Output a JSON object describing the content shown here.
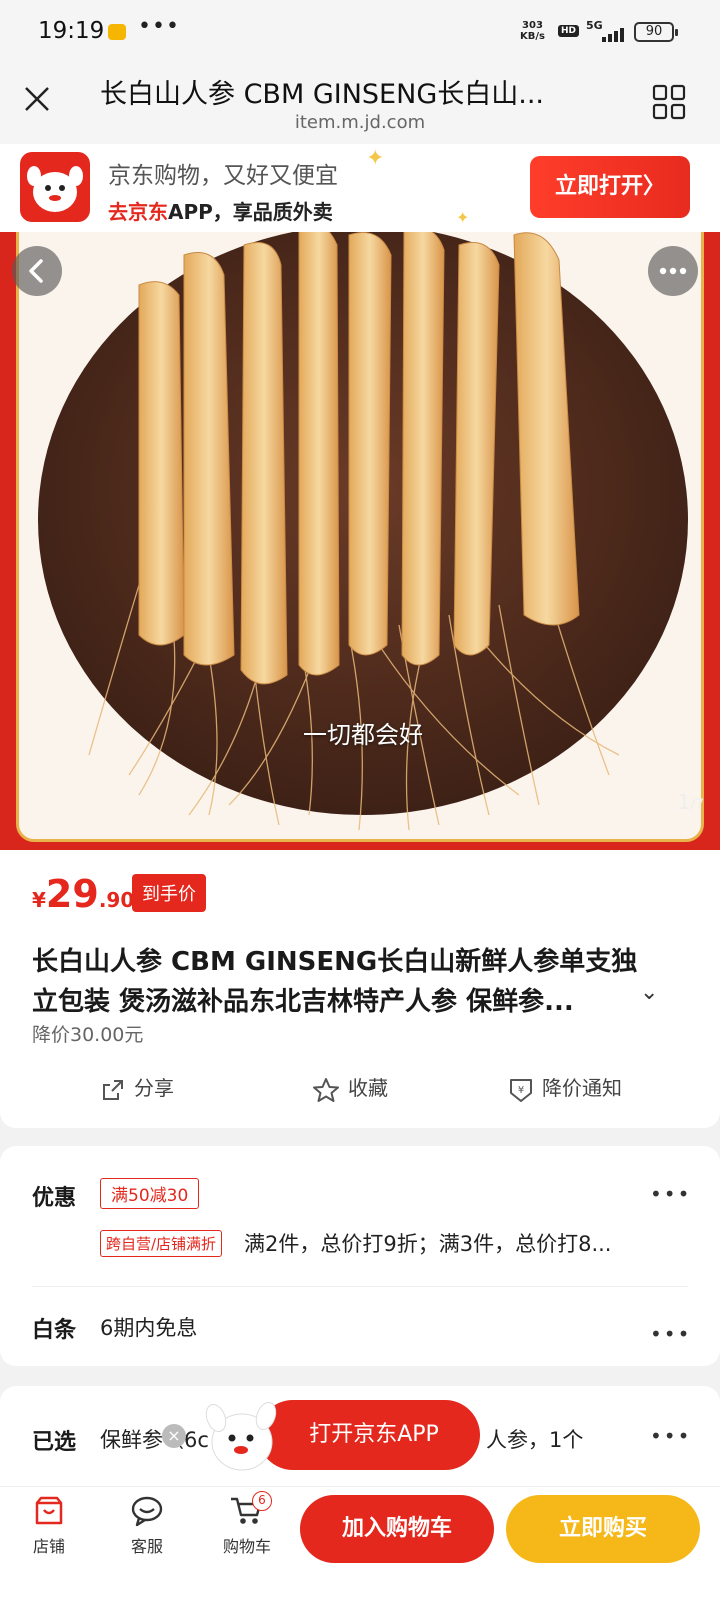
{
  "status_bar": {
    "time": "19:19",
    "more": "•••",
    "net_speed_value": "303",
    "net_speed_unit": "KB/s",
    "hd": "HD",
    "network": "5G",
    "battery": "90"
  },
  "title_bar": {
    "title": "长白山人参 CBM GINSENG长白山...",
    "url": "item.m.jd.com"
  },
  "app_banner": {
    "line1": "京东购物，又好又便宜",
    "line2_red": "去京东",
    "line2_rest": "APP，享品质外卖",
    "open_button": "立即打开",
    "open_arrow": "〉"
  },
  "hero": {
    "caption": "一切都会好",
    "page_current": "1",
    "page_total": "/7",
    "back_icon": "chevron-left-icon",
    "more_icon": "more-dots-icon"
  },
  "product": {
    "currency": "¥",
    "price_int": "29",
    "price_dec": ".90",
    "price_tag": "到手价",
    "title_line1": "长白山人参 CBM GINSENG长白山新鲜人参单支独",
    "title_line2": "立包装 煲汤滋补品东北吉林特产人参 保鲜参...",
    "expand": "⌄",
    "price_drop": "降价30.00元",
    "actions": {
      "share": "分享",
      "favorite": "收藏",
      "price_alert": "降价通知"
    }
  },
  "promo": {
    "label": "优惠",
    "coupon": "满50减30",
    "tag": "跨自营/店铺满折",
    "text": "满2件，总价打9折；满3件，总价打8...",
    "dots": "•••",
    "baitiao_label": "白条",
    "baitiao_text": "6期内免息"
  },
  "selected": {
    "label": "已选",
    "text_left": "保鲜参（6c",
    "text_right": "人参，1个",
    "dots": "•••"
  },
  "floating": {
    "open_app": "打开京东APP",
    "close": "×"
  },
  "bottom_bar": {
    "shop": "店铺",
    "service": "客服",
    "cart": "购物车",
    "cart_count": "6",
    "add_to_cart": "加入购物车",
    "buy_now": "立即购买"
  },
  "colors": {
    "accent_red": "#e4281e",
    "buy_yellow": "#f5b818"
  }
}
